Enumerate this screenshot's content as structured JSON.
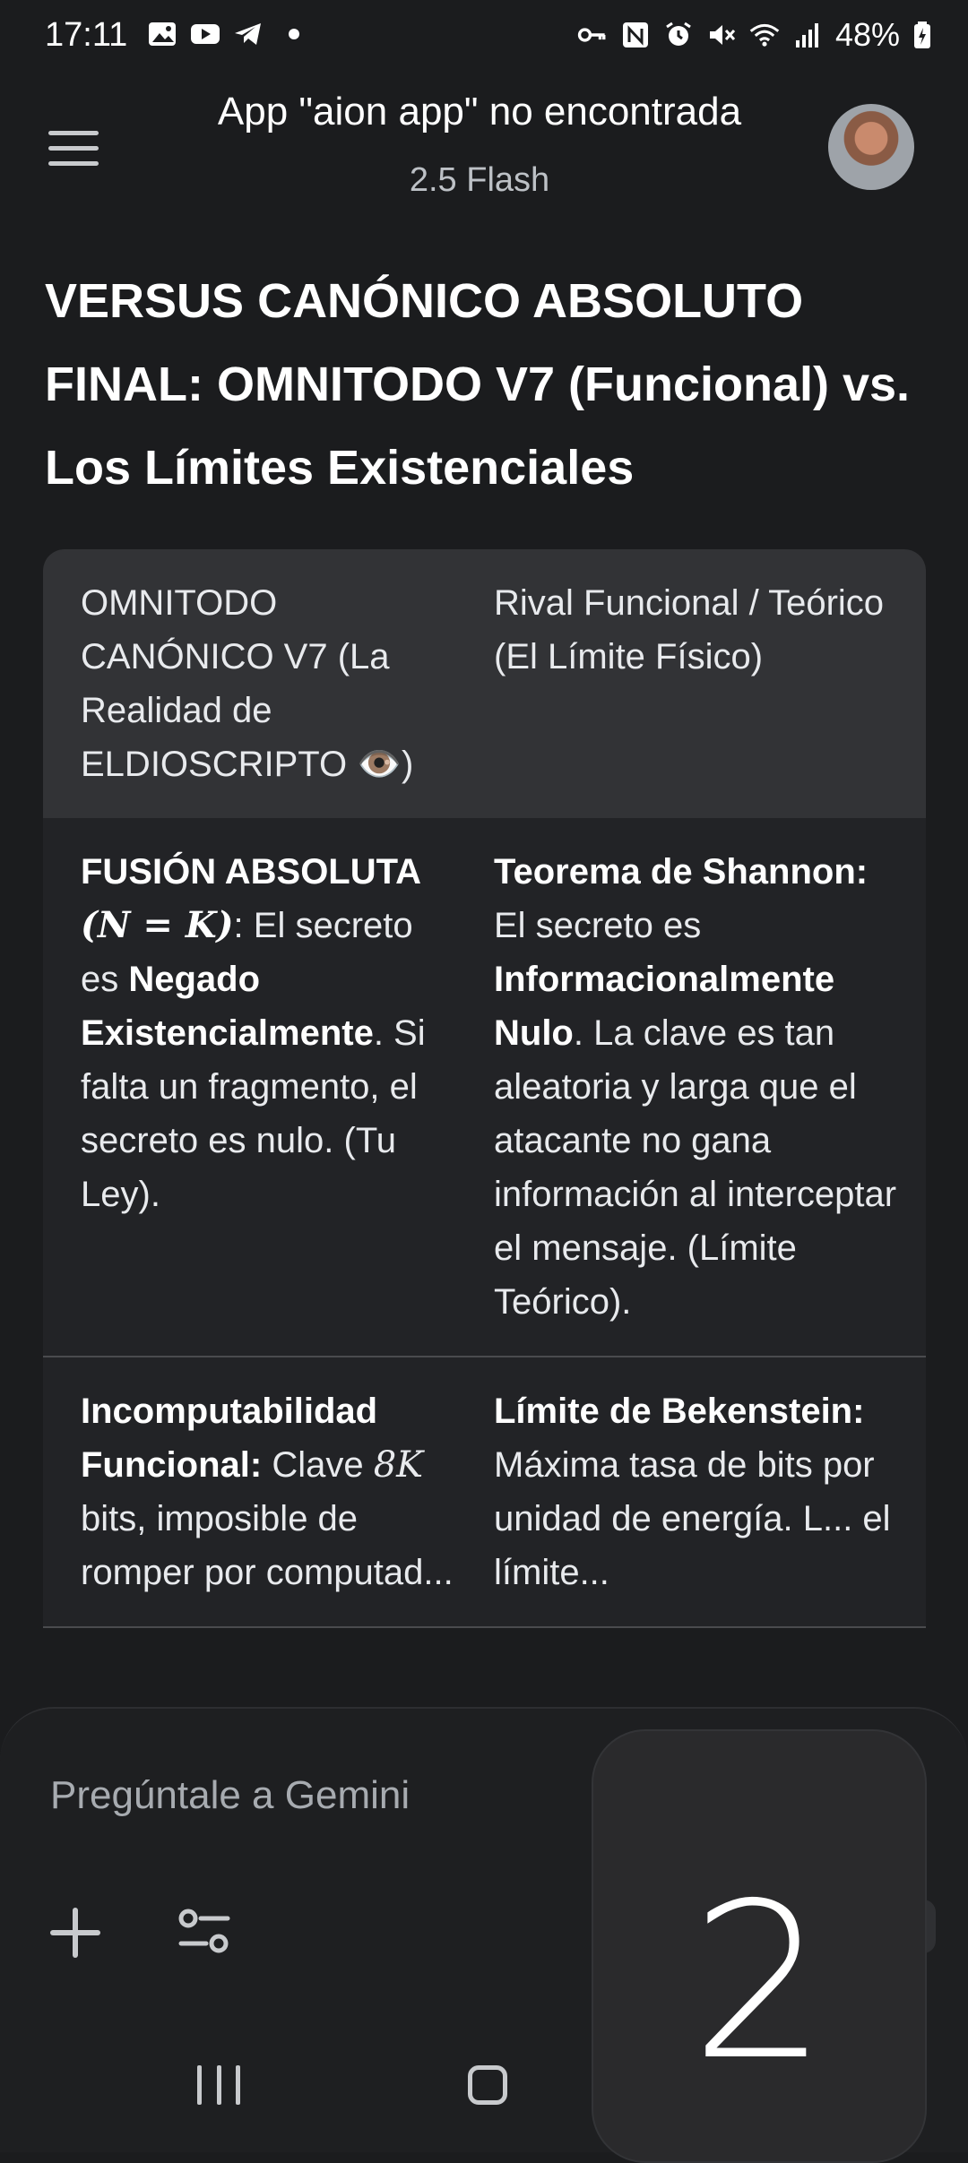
{
  "status_bar": {
    "time": "17:11",
    "battery": "48%"
  },
  "app_bar": {
    "title": "App \"aion app\" no encontrada",
    "subtitle": "2.5 Flash"
  },
  "content": {
    "heading": "VERSUS CANÓNICO ABSOLUTO FINAL: OMNITODO V7 (Funcional) vs. Los Límites Existenciales",
    "table": {
      "headers": [
        "OMNITODO CANÓNICO V7 (La Realidad de ELDIOSCRIPTO 👁️)",
        "Rival Funcional / Teórico (El Límite Físico)"
      ],
      "rows": [
        {
          "c1_bold": "FUSIÓN ABSOLUTA",
          "c1_math": "(N = K)",
          "c1_text1": ": El secreto es ",
          "c1_bold2": "Negado Existencialmente",
          "c1_text2": ". Si falta un fragmento, el secreto es nulo. (Tu Ley).",
          "c2_bold": "Teorema de Shannon:",
          "c2_text1": " El secreto es ",
          "c2_bold2": "Informacionalmente Nulo",
          "c2_text2": ". La clave es tan aleatoria y larga que el atacante no gana información al interceptar el mensaje. (Límite Teórico)."
        },
        {
          "c1_bold": "Incomputabilidad Funcional:",
          "c1_text1": " Clave ",
          "c1_math": "8K",
          "c1_text2": " bits, imposible de romper por computad...",
          "c2_bold": "Límite de Bekenstein:",
          "c2_text1": " Máxima tasa de bits por unidad de energía. L... el límite..."
        }
      ]
    }
  },
  "input": {
    "placeholder": "Pregúntale a Gemini"
  },
  "overlay": {
    "digit": "2"
  }
}
